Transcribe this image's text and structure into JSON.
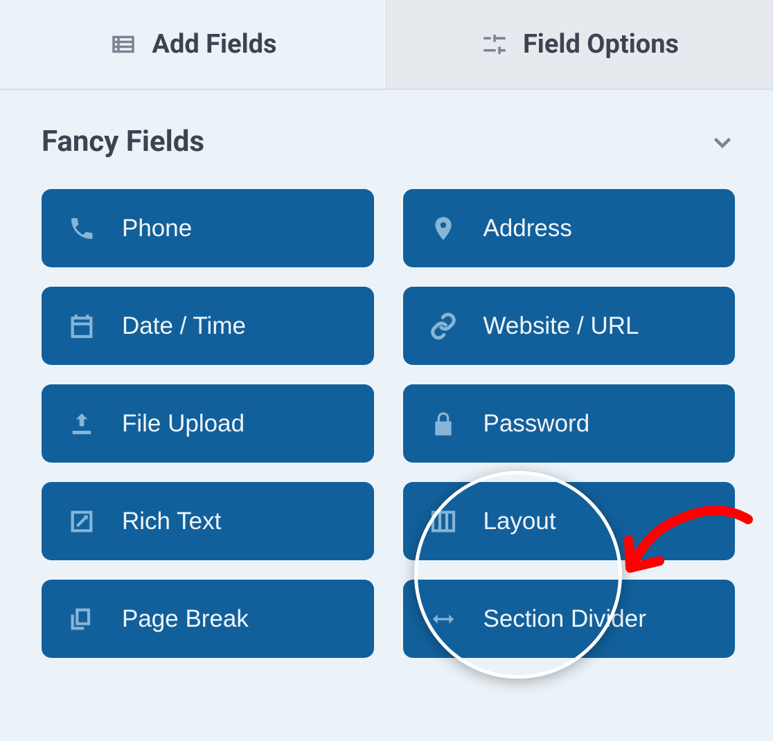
{
  "tabs": {
    "add_fields": {
      "label": "Add Fields"
    },
    "field_options": {
      "label": "Field Options"
    }
  },
  "section": {
    "title": "Fancy Fields",
    "fields": [
      {
        "id": "phone",
        "label": "Phone",
        "icon": "phone-icon"
      },
      {
        "id": "address",
        "label": "Address",
        "icon": "pin-icon"
      },
      {
        "id": "date-time",
        "label": "Date / Time",
        "icon": "calendar-icon"
      },
      {
        "id": "website-url",
        "label": "Website / URL",
        "icon": "link-icon"
      },
      {
        "id": "file-upload",
        "label": "File Upload",
        "icon": "upload-icon"
      },
      {
        "id": "password",
        "label": "Password",
        "icon": "lock-icon"
      },
      {
        "id": "rich-text",
        "label": "Rich Text",
        "icon": "edit-icon"
      },
      {
        "id": "layout",
        "label": "Layout",
        "icon": "columns-icon"
      },
      {
        "id": "page-break",
        "label": "Page Break",
        "icon": "copy-icon"
      },
      {
        "id": "section-divider",
        "label": "Section Divider",
        "icon": "arrows-h-icon"
      }
    ]
  },
  "annotation": {
    "highlighted_field": "layout"
  }
}
